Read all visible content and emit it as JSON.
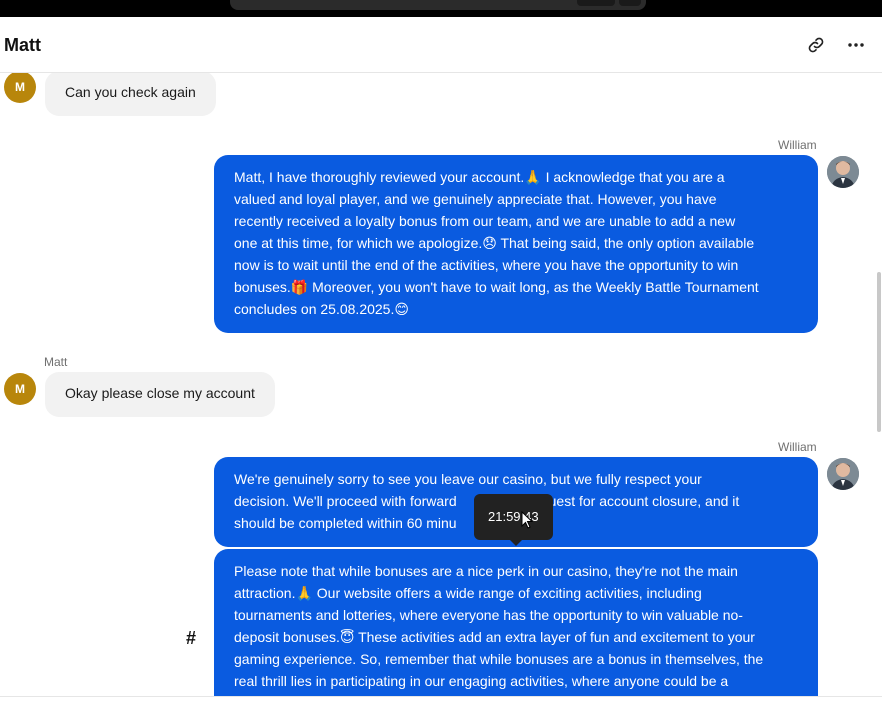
{
  "header": {
    "title": "Matt",
    "link_icon": "link-icon",
    "more_icon": "more-horizontal-icon"
  },
  "colors": {
    "agent_bubble": "#0a5be0",
    "customer_bubble": "#f2f2f2",
    "customer_avatar": "#b8860b"
  },
  "messages": [
    {
      "side": "customer",
      "initial": "M",
      "text": "Can you check again"
    },
    {
      "side": "agent",
      "sender": "William",
      "lines": [
        "Matt, I have thoroughly reviewed your account.🙏 I acknowledge that you are a",
        "valued and loyal player, and we genuinely appreciate that. However, you have",
        "recently received a loyalty bonus from our team, and we are unable to add a new",
        "one at this time, for which we apologize.😞 That being said, the only option available",
        "now is to wait until the end of the activities, where you have the opportunity to win",
        "bonuses.🎁 Moreover, you won't have to wait long, as the Weekly Battle Tournament",
        "concludes on 25.08.2025.😊"
      ]
    },
    {
      "side": "customer",
      "sender": "Matt",
      "initial": "M",
      "text": "Okay please close my account"
    },
    {
      "side": "agent",
      "sender": "William",
      "lines": [
        "We're genuinely sorry to see you leave our casino, but we fully respect your",
        "decision. We'll proceed with forward",
        "uest for account closure, and it",
        "should be completed within 60 minu"
      ]
    },
    {
      "side": "agent",
      "lines": [
        "Please note that while bonuses are a nice perk in our casino, they're not the main",
        "attraction.🙏 Our website offers a wide range of exciting activities, including",
        "tournaments and lotteries, where everyone has the opportunity to win valuable no-",
        "deposit bonuses.😇 These activities add an extra layer of fun and excitement to your",
        "gaming experience. So, remember that while bonuses are a bonus in themselves, the",
        "real thrill lies in participating in our engaging activities, where anyone could be a"
      ]
    }
  ],
  "tooltip": {
    "time": "21:59:43"
  },
  "hash_icon": "#"
}
